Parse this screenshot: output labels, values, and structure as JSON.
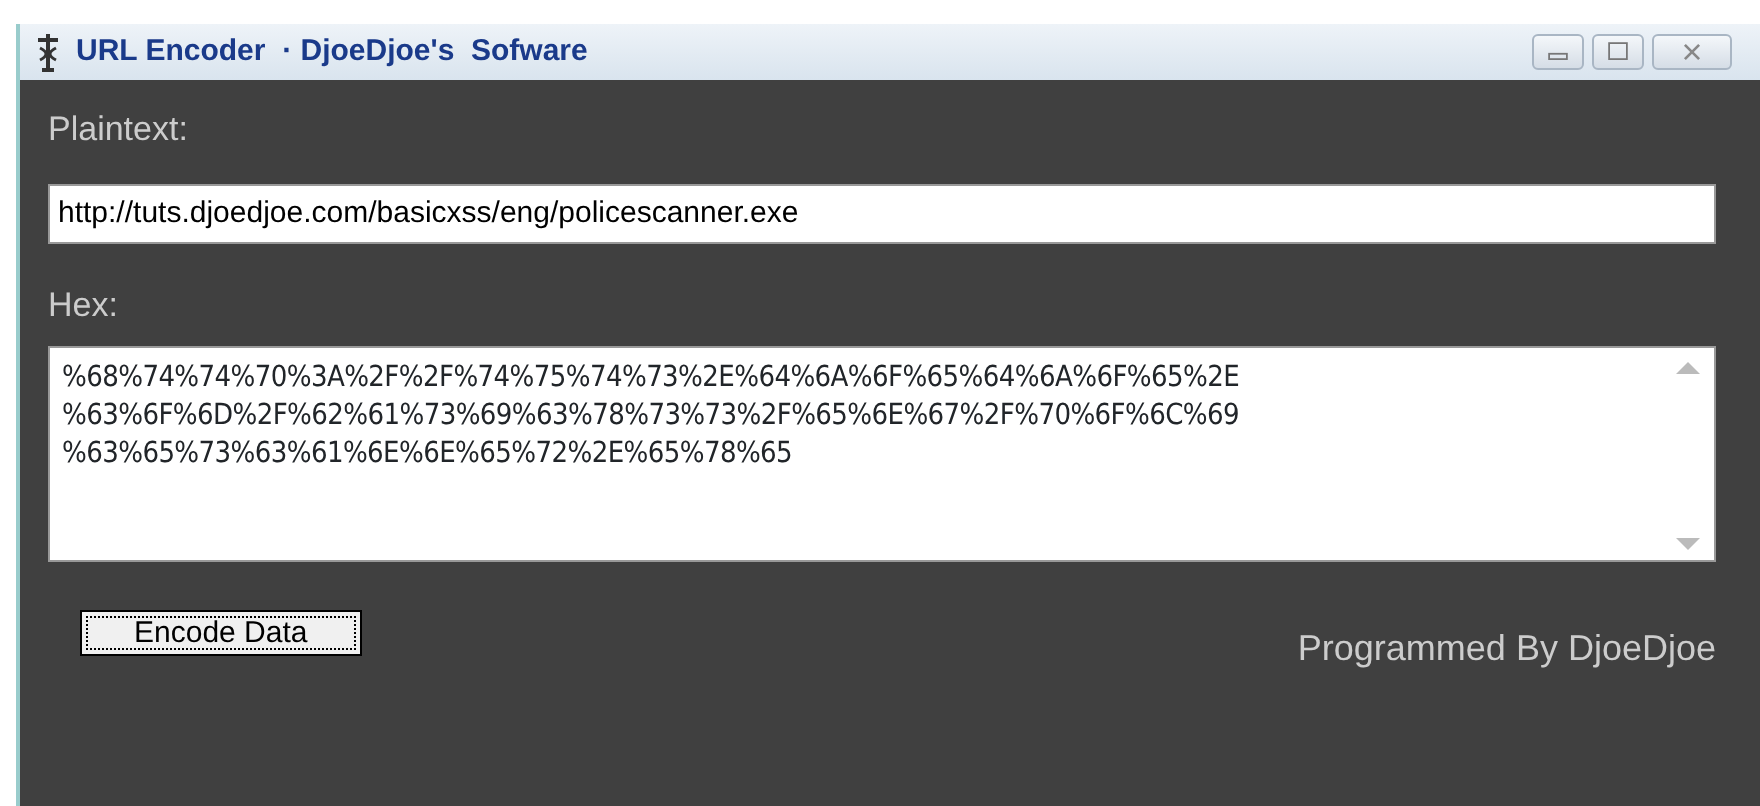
{
  "window": {
    "title": "URL Encoder  · DjoeDjoe's  Sofware"
  },
  "plaintext": {
    "label": "Plaintext:",
    "value": "http://tuts.djoedjoe.com/basicxss/eng/policescanner.exe"
  },
  "hex": {
    "label": "Hex:",
    "value_lines": [
      "%68%74%74%70%3A%2F%2F%74%75%74%73%2E%64%6A%6F%65%64%6A%6F%65%2E",
      "%63%6F%6D%2F%62%61%73%69%63%78%73%73%2F%65%6E%67%2F%70%6F%6C%69",
      "%63%65%73%63%61%6E%6E%65%72%2E%65%78%65"
    ]
  },
  "buttons": [
    {
      "label": "Encode Data",
      "focused": true
    }
  ],
  "footer": "Programmed By DjoeDjoe"
}
